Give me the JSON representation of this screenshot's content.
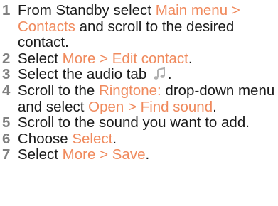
{
  "colors": {
    "number": "#808080",
    "text": "#1a1a1a",
    "highlight": "#f08a5d",
    "icon": "#b0b0b0"
  },
  "steps": [
    {
      "number": "1",
      "t1": "From Standby select ",
      "h1": "Main menu > Contacts",
      "t2": " and scroll to the desired contact."
    },
    {
      "number": "2",
      "t1": "Select ",
      "h1": "More > Edit contact",
      "t2": "."
    },
    {
      "number": "3",
      "t1": "Select the audio tab",
      "icon": "music-note-icon",
      "t2": "."
    },
    {
      "number": "4",
      "t1": "Scroll to the ",
      "h1": "Ringtone:",
      "t2": " drop-down menu and select ",
      "h2": "Open > Find sound",
      "t3": "."
    },
    {
      "number": "5",
      "t1": "Scroll to the sound you want to add."
    },
    {
      "number": "6",
      "t1": "Choose ",
      "h1": "Select",
      "t2": "."
    },
    {
      "number": "7",
      "t1": "Select ",
      "h1": "More > Save",
      "t2": "."
    }
  ]
}
